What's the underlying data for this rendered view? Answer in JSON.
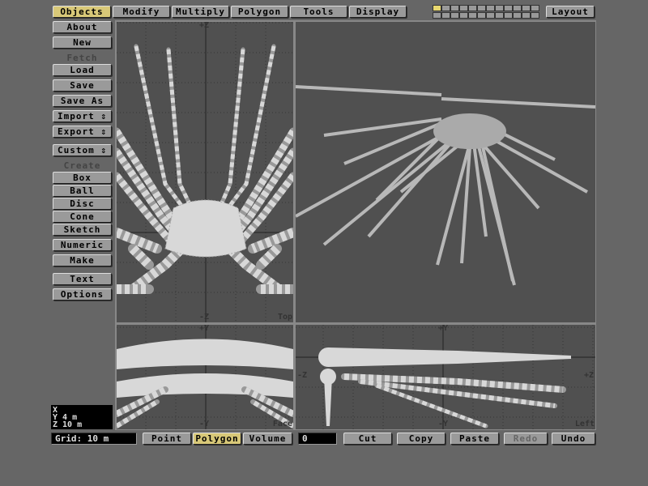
{
  "tabs": [
    {
      "label": "Objects",
      "active": true
    },
    {
      "label": "Modify"
    },
    {
      "label": "Multiply"
    },
    {
      "label": "Polygon"
    },
    {
      "label": "Tools"
    },
    {
      "label": "Display"
    }
  ],
  "layout_button": "Layout",
  "sidebar": {
    "about": "About",
    "new": "New",
    "fetch_header": "Fetch",
    "load": "Load",
    "save": "Save",
    "save_as": "Save As",
    "import": "Import",
    "export": "Export",
    "custom": "Custom",
    "create_header": "Create",
    "box": "Box",
    "ball": "Ball",
    "disc": "Disc",
    "cone": "Cone",
    "sketch": "Sketch",
    "numeric": "Numeric",
    "make": "Make",
    "text": "Text",
    "options": "Options",
    "updown_icon": "updown-arrow-icon"
  },
  "coords": {
    "x": "X",
    "y": "Y 4 m",
    "z": "Z 10 m"
  },
  "bottom": {
    "grid": "Grid: 10 m",
    "modes": [
      {
        "label": "Point"
      },
      {
        "label": "Polygon",
        "active": true
      },
      {
        "label": "Volume"
      }
    ],
    "count": "0",
    "cut": "Cut",
    "copy": "Copy",
    "paste": "Paste",
    "redo": "Redo",
    "undo": "Undo"
  },
  "viewports": {
    "top": {
      "name": "Top",
      "up": "+Z",
      "down": "-Z"
    },
    "face": {
      "name": "Face",
      "up": "+Y",
      "down": "-Y"
    },
    "left": {
      "name": "Left",
      "up": "+Y",
      "down": "-Y",
      "left": "-Z",
      "right": "+Z"
    }
  },
  "colors": {
    "active": "#d8c878",
    "button": "#9a9a9a",
    "viewport": "#505050",
    "mesh": "#d8d8d8"
  }
}
